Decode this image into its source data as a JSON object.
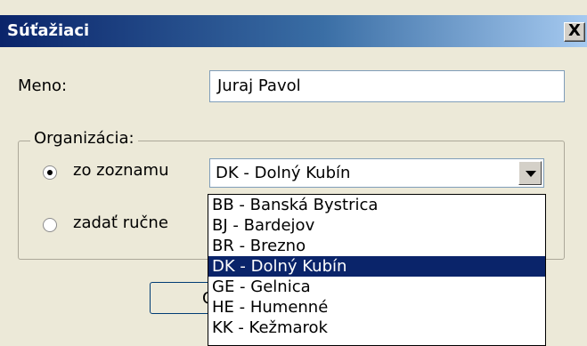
{
  "dialog": {
    "title": "Súťažiaci",
    "close_symbol": "X"
  },
  "form": {
    "name_label": "Meno:",
    "name_value": "Juraj Pavol",
    "organization_legend": "Organizácia:",
    "radio_list_label": "zo zoznamu",
    "radio_manual_label": "zadať ručne",
    "selected_mode": "zo zoznamu",
    "combo_value": "DK - Dolný Kubín",
    "ok_partial": "O"
  },
  "dropdown": {
    "items": [
      "BB - Banská Bystrica",
      "BJ - Bardejov",
      "BR - Brezno",
      "DK - Dolný Kubín",
      "GE - Gelnica",
      "HE - Humenné",
      "KK - Kežmarok"
    ],
    "selected_index": 3
  },
  "colors": {
    "title_start": "#0a246a",
    "title_end": "#a6caf0",
    "selection": "#0a246a",
    "face": "#ece9d8"
  }
}
